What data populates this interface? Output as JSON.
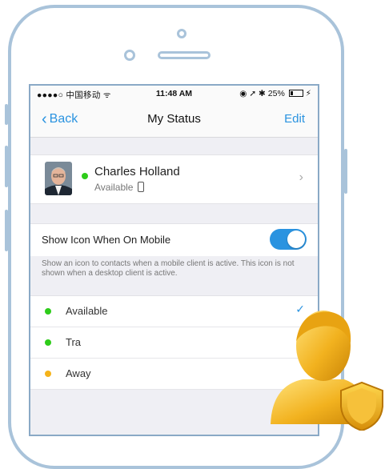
{
  "status_bar": {
    "carrier": "●●●●○ 中国移动 ᯤ",
    "time": "11:48 AM",
    "indicators": "◉ ➚ ✱ 25%",
    "battery_percent": 25
  },
  "nav": {
    "back_label": "Back",
    "title": "My Status",
    "edit_label": "Edit"
  },
  "profile": {
    "name": "Charles Holland",
    "status": "Available",
    "presence_color": "#2ecc1a"
  },
  "mobile_icon": {
    "label": "Show Icon When On Mobile",
    "enabled": true,
    "help_text": "Show an icon to contacts when a mobile client is active. This icon is not shown when a desktop client is active."
  },
  "statuses": [
    {
      "label": "Available",
      "color": "#2ecc1a",
      "selected": true
    },
    {
      "label": "Tra",
      "color": "#2ecc1a",
      "selected": false
    },
    {
      "label": "Away",
      "color": "#f5b31a",
      "selected": false
    }
  ],
  "colors": {
    "accent": "#2a93e0",
    "frame": "#a9c3da"
  },
  "icons": {
    "chevron_left": "‹",
    "chevron_right": "›",
    "check": "✓"
  }
}
